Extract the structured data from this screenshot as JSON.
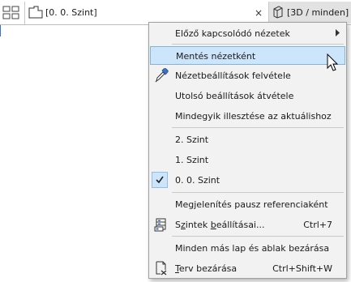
{
  "tabs": {
    "active": {
      "label": "[0. 0. Szint]",
      "close": "×"
    },
    "second": {
      "label": "[3D / minden]"
    }
  },
  "menu": {
    "previous_views": "Előző kapcsolódó nézetek",
    "save_as_view": "Mentés nézetként",
    "capture_view_settings": "Nézetbeállítások felvétele",
    "apply_last_settings": "Utolsó beállítások átvétele",
    "fit_all": "Mindegyik illesztése az aktuálishoz",
    "stories": [
      "2. Szint",
      "1. Szint",
      "0. 0. Szint"
    ],
    "checked_story": "0. 0. Szint",
    "show_as_trace": "Megjelenítés pausz referenciaként",
    "story_settings": {
      "prefix": "S",
      "underlined": "z",
      "middle": "intek ",
      "underlined2": "b",
      "rest": "eállításai...",
      "shortcut": "Ctrl+7"
    },
    "close_all_other": "Minden más lap és ablak bezárása",
    "close_project": {
      "underlined": "T",
      "rest": "erv bezárása",
      "shortcut": "Ctrl+Shift+W"
    }
  }
}
